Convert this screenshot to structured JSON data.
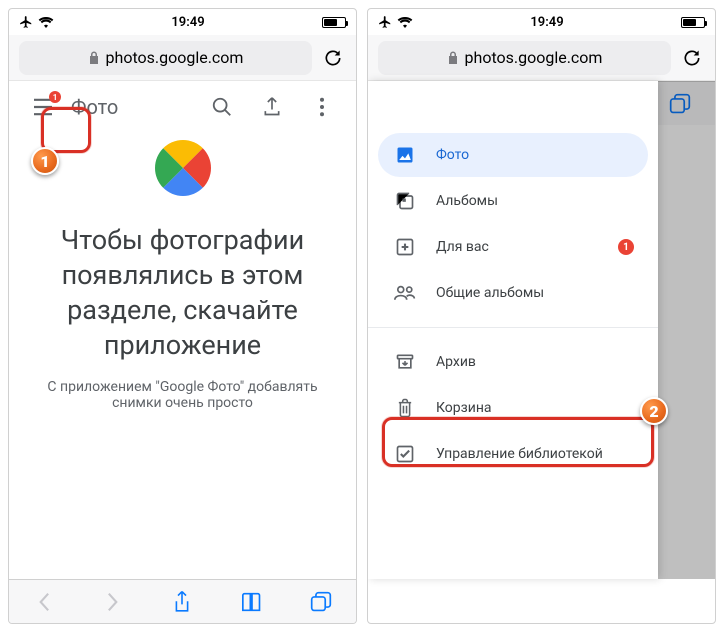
{
  "status": {
    "time": "19:49"
  },
  "urlbar": {
    "host": "photos.google.com"
  },
  "toolbar": {
    "title": "Фото",
    "hamburger_badge": "1"
  },
  "screen1": {
    "heading": "Чтобы фотографии появлялись в этом разделе, скачайте приложение",
    "subtext": "С приложением \"Google Фото\" добавлять снимки очень просто"
  },
  "drawer": {
    "items": [
      {
        "label": "Фото",
        "icon": "image",
        "active": true
      },
      {
        "label": "Альбомы",
        "icon": "albums"
      },
      {
        "label": "Для вас",
        "icon": "foryou",
        "badge": "1"
      },
      {
        "label": "Общие альбомы",
        "icon": "shared"
      }
    ],
    "items2": [
      {
        "label": "Архив",
        "icon": "archive"
      },
      {
        "label": "Корзина",
        "icon": "trash"
      },
      {
        "label": "Управление библиотекой",
        "icon": "manage"
      }
    ]
  },
  "annotations": {
    "step1": "1",
    "step2": "2"
  }
}
